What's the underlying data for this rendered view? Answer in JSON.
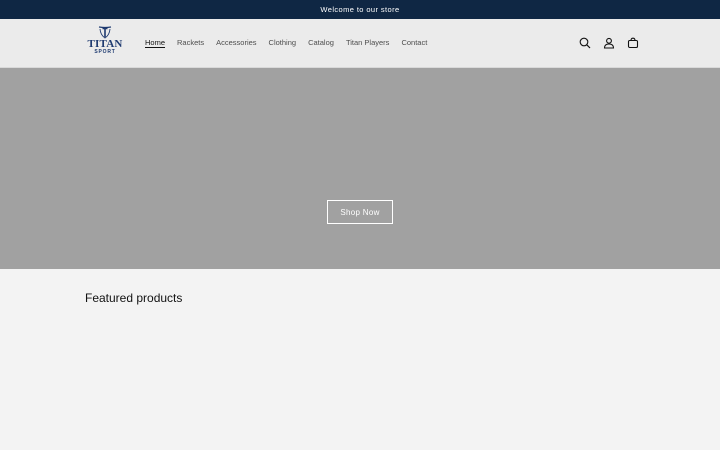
{
  "announcement": {
    "text": "Welcome to our store"
  },
  "header": {
    "logo": {
      "word": "TITAN",
      "sub": "SPORT"
    },
    "nav": [
      {
        "label": "Home",
        "active": true
      },
      {
        "label": "Rackets"
      },
      {
        "label": "Accessories"
      },
      {
        "label": "Clothing"
      },
      {
        "label": "Catalog"
      },
      {
        "label": "Titan Players"
      },
      {
        "label": "Contact"
      }
    ],
    "icons": [
      "search-icon",
      "account-icon",
      "cart-icon"
    ]
  },
  "hero": {
    "button_label": "Shop Now"
  },
  "featured": {
    "title": "Featured products"
  },
  "colors": {
    "announcement_bg": "#0f2744",
    "brand": "#1e3a70",
    "hero_bg": "#a1a1a1",
    "page_bg": "#f3f3f3"
  }
}
